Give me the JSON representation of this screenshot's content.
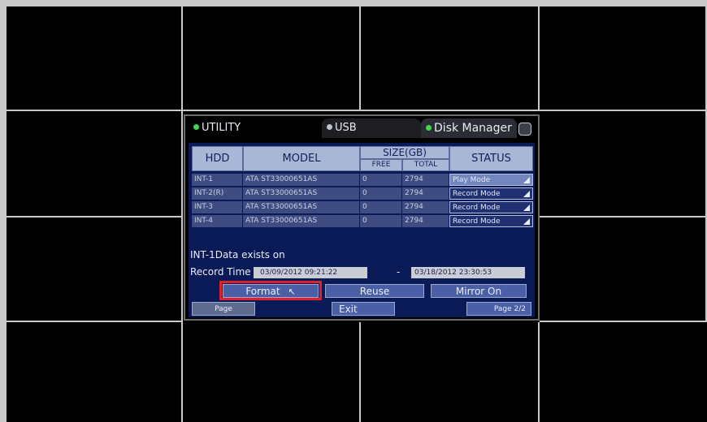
{
  "tabs": {
    "utility": "UTILITY",
    "usb": "USB",
    "disk_manager": "Disk Manager"
  },
  "table": {
    "headers": {
      "hdd": "HDD",
      "model": "MODEL",
      "size": "SIZE(GB)",
      "free": "FREE",
      "total": "TOTAL",
      "status": "STATUS"
    },
    "rows": [
      {
        "hdd": "INT-1",
        "model": "ATA ST33000651AS",
        "free": "0",
        "total": "2794",
        "status": "Play Mode"
      },
      {
        "hdd": "INT-2(R)",
        "model": "ATA ST33000651AS",
        "free": "0",
        "total": "2794",
        "status": "Record Mode"
      },
      {
        "hdd": "INT-3",
        "model": "ATA ST33000651AS",
        "free": "0",
        "total": "2794",
        "status": "Record Mode"
      },
      {
        "hdd": "INT-4",
        "model": "ATA ST33000651AS",
        "free": "0",
        "total": "2794",
        "status": "Record Mode"
      }
    ]
  },
  "info": {
    "message": "INT-1Data exists on",
    "record_time_label": "Record Time",
    "start_time": "03/09/2012 09:21:22",
    "separator": "-",
    "end_time": "03/18/2012 23:30:53"
  },
  "buttons": {
    "format": "Format",
    "reuse": "Reuse",
    "mirror_on": "Mirror On",
    "page": "Page",
    "exit": "Exit",
    "page_num": "Page 2/2"
  },
  "colors": {
    "highlight": "#e1202a",
    "status_dot": "#46d64e"
  }
}
